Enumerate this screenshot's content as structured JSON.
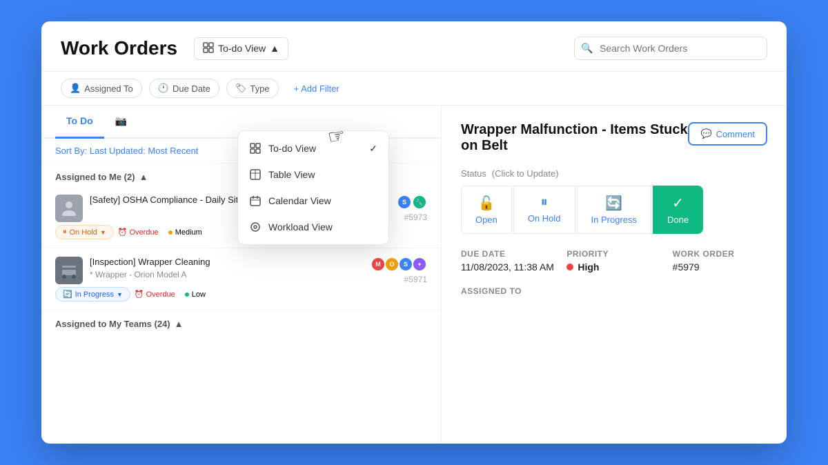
{
  "header": {
    "title": "Work Orders",
    "view_toggle_label": "To-do View",
    "search_placeholder": "Search Work Orders"
  },
  "filters": {
    "chips": [
      {
        "id": "assigned-to",
        "label": "Assigned To",
        "icon": "person"
      },
      {
        "id": "due-date",
        "label": "Due Date",
        "icon": "clock"
      },
      {
        "id": "type",
        "label": "Type",
        "icon": "tag"
      }
    ],
    "add_filter_label": "+ Add Filter"
  },
  "tabs": [
    {
      "id": "todo",
      "label": "To Do",
      "active": true
    },
    {
      "id": "tab2",
      "label": "",
      "active": false
    }
  ],
  "sort_bar": {
    "prefix": "Sort By:",
    "value": "Last Updated: Most Recent"
  },
  "sections": [
    {
      "title": "Assigned to Me (2)",
      "expanded": true,
      "items": [
        {
          "id": "wo1",
          "title": "[Safety] OSHA Compliance - Daily Site Walk",
          "number": "#5973",
          "status": "On Hold",
          "overdue": true,
          "priority": "Medium",
          "priority_color": "#f59e0b",
          "avatar_color": "#9ca3af",
          "assignee_colors": [
            "#3b82f6",
            "#10b981"
          ]
        },
        {
          "id": "wo2",
          "title": "[Inspection] Wrapper Cleaning",
          "sub": "* Wrapper - Orion Model A",
          "number": "#5971",
          "status": "In Progress",
          "overdue": true,
          "priority": "Low",
          "priority_color": "#10b981",
          "avatar_color": "#6b7280",
          "assignee_colors": [
            "#ef4444",
            "#f59e0b",
            "#3b82f6",
            "#8b5cf6"
          ]
        }
      ]
    },
    {
      "title": "Assigned to My Teams (24)",
      "expanded": true,
      "items": []
    }
  ],
  "dropdown": {
    "items": [
      {
        "id": "todo-view",
        "label": "To-do View",
        "checked": true,
        "icon": "grid"
      },
      {
        "id": "table-view",
        "label": "Table View",
        "checked": false,
        "icon": "table"
      },
      {
        "id": "calendar-view",
        "label": "Calendar View",
        "checked": false,
        "icon": "calendar"
      },
      {
        "id": "workload-view",
        "label": "Workload View",
        "checked": false,
        "icon": "workload"
      }
    ]
  },
  "detail_panel": {
    "title": "Wrapper Malfunction - Items Stuck on Belt",
    "comment_btn": "Comment",
    "status_section": {
      "label": "Status",
      "sub_label": "(Click to Update)",
      "buttons": [
        {
          "id": "open",
          "label": "Open",
          "icon": "🔓",
          "active": false
        },
        {
          "id": "on-hold",
          "label": "On Hold",
          "icon": "⏸",
          "active": false
        },
        {
          "id": "in-progress",
          "label": "In Progress",
          "icon": "🔄",
          "active": false
        },
        {
          "id": "done",
          "label": "Done",
          "icon": "✓",
          "active": true
        }
      ]
    },
    "due_date_label": "Due Date",
    "due_date_value": "11/08/2023, 11:38 AM",
    "priority_label": "Priority",
    "priority_value": "High",
    "priority_color": "#ef4444",
    "work_order_label": "Work Order",
    "work_order_value": "#5979",
    "assigned_to_label": "Assigned To"
  }
}
